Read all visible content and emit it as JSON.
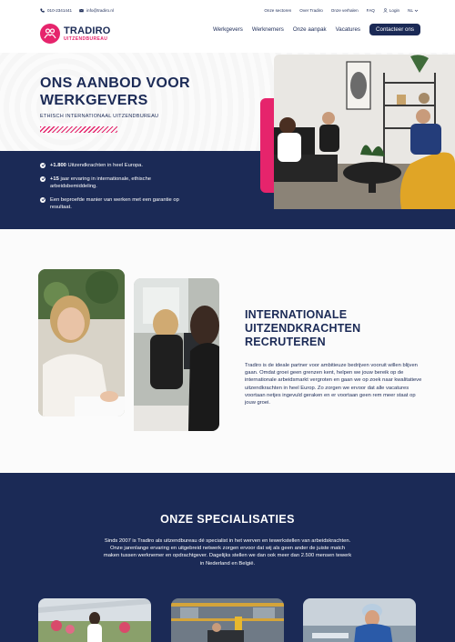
{
  "topbar": {
    "phone": "010-2341441",
    "email": "info@tradiro.nl",
    "links": [
      "Onze sectoren",
      "Over Tradiro",
      "Onze verhalen",
      "FAQ"
    ],
    "login": "Login",
    "language": "NL"
  },
  "brand": {
    "name": "TRADIRO",
    "tagline": "UITZENDBUREAU",
    "color": "#e6246c",
    "navy": "#1b2a56"
  },
  "nav": {
    "items": [
      "Werkgevers",
      "Werknemers",
      "Onze aanpak",
      "Vacatures"
    ],
    "cta": "Contacteer ons"
  },
  "hero": {
    "title_line1": "ONS AANBOD VOOR",
    "title_line2": "WERKGEVERS",
    "subtitle": "ETHISCH INTERNATIONAAL UITZENDBUREAU",
    "bullets": [
      {
        "strong": "+1.800",
        "text": " Uitzendkrachten in heel Europa."
      },
      {
        "strong": "+15",
        "text": " jaar ervaring in internationale, ethische arbeidsbemiddeling."
      },
      {
        "strong": "",
        "text": "Een beproefde manier van werken met een garantie op resultaat."
      }
    ]
  },
  "recruteren": {
    "title_line1": "INTERNATIONALE",
    "title_line2": "UITZENDKRACHTEN",
    "title_line3": "RECRUTEREN",
    "body": "Tradiro is de ideale partner voor ambitieuze bedrijven vooruit willen blijven gaan. Omdat groei geen grenzen kent, helpen we jouw bereik op de internationale arbeidsmarkt vergroten en gaan we op zoek naar kwalitatieve uitzendkrachten in heel Europ. Zo zorgen we ervoor dat alle vacatures voortaan netjes ingevuld geraken en er voortaan geen rem meer staat op jouw groei."
  },
  "specialisaties": {
    "title": "ONZE SPECIALISATIES",
    "body": "Sinds 2007 is Tradiro als uitzendbureau dé specialist in het werven en tewerkstellen van arbeidskrachten. Onze jarenlange ervaring en uitgebreid netwerk zorgen ervoor dat wij als geen ander de juiste match maken tussen werknemer en opdrachtgever. Dagelijks stellen we dan ook meer dan 2.500 mensen tewerk in Nederland en België."
  }
}
